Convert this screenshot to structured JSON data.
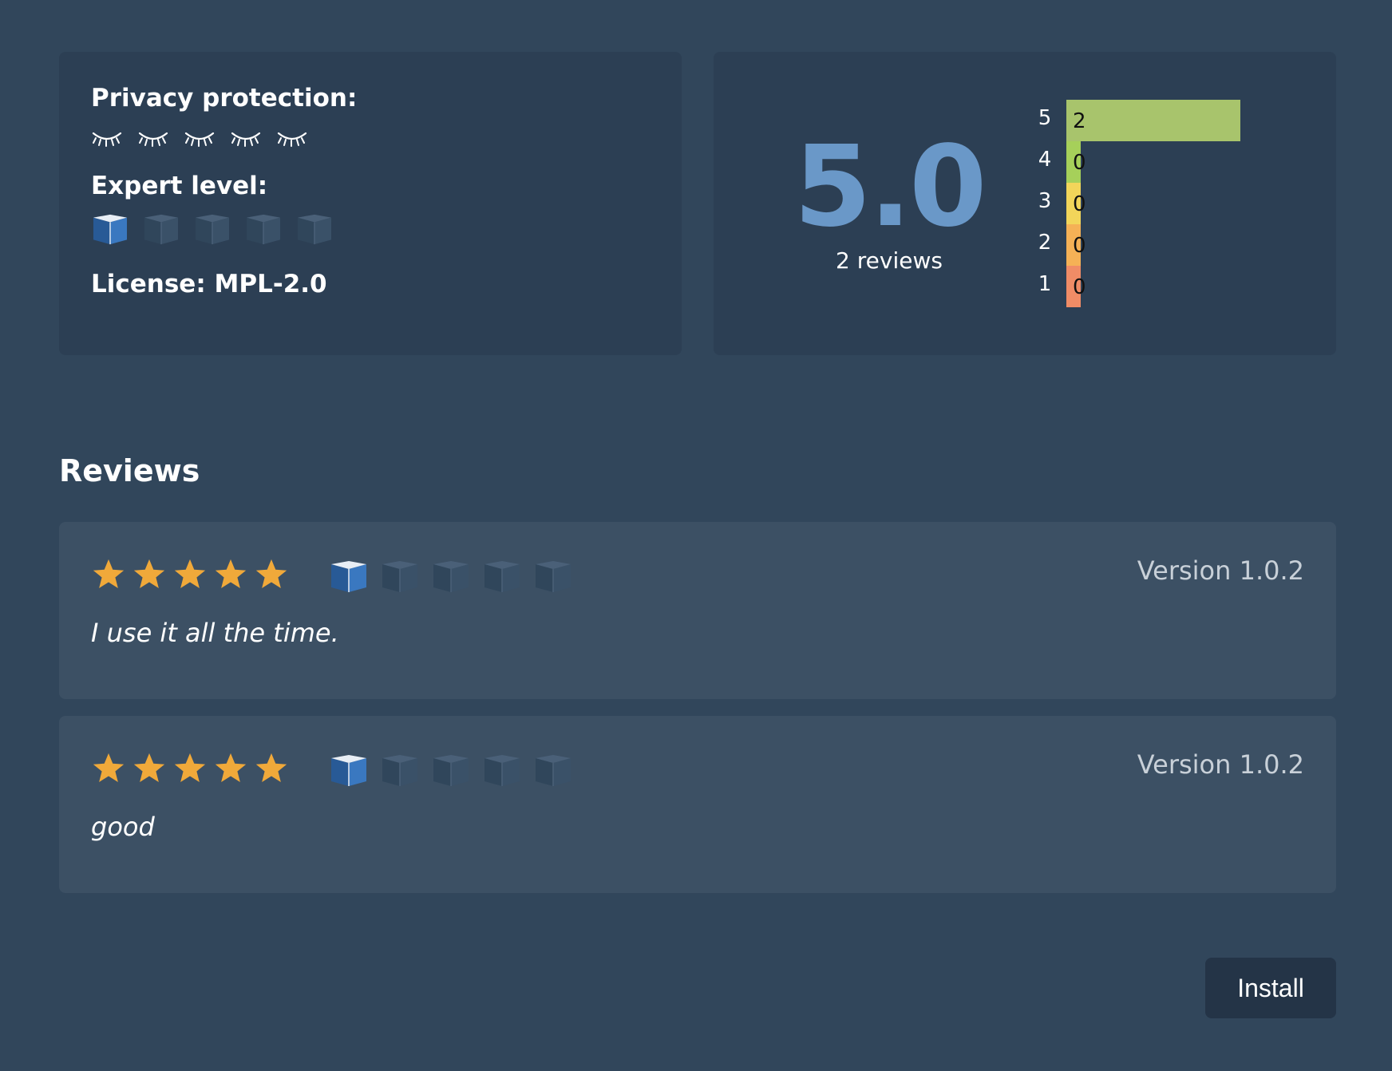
{
  "info": {
    "privacy_label": "Privacy protection:",
    "privacy_icon": "closed-eye-icon",
    "privacy_level": 5,
    "privacy_max": 5,
    "expert_label": "Expert level:",
    "expert_icon": "book-icon",
    "expert_level": 1,
    "expert_max": 5,
    "license_text": "License: MPL-2.0"
  },
  "rating": {
    "score": "5.0",
    "count_text": "2 reviews",
    "distribution": [
      {
        "stars": "5",
        "count": 2,
        "color": "#a8c46c"
      },
      {
        "stars": "4",
        "count": 0,
        "color": "#a6d05a"
      },
      {
        "stars": "3",
        "count": 0,
        "color": "#f2d55a"
      },
      {
        "stars": "2",
        "count": 0,
        "color": "#f5b156"
      },
      {
        "stars": "1",
        "count": 0,
        "color": "#f08c66"
      }
    ]
  },
  "reviews_title": "Reviews",
  "reviews": [
    {
      "stars": 5,
      "expert_level": 1,
      "version": "Version 1.0.2",
      "text": "I use it all the time."
    },
    {
      "stars": 5,
      "expert_level": 1,
      "version": "Version 1.0.2",
      "text": "good"
    }
  ],
  "colors": {
    "background": "#31465b",
    "card": "#2c3f54",
    "review_card": "#3c5064",
    "score": "#6a98c8",
    "star": "#f0a93a",
    "book_active": "#3a78c0",
    "book_inactive": "#3a5168",
    "button": "#243447"
  },
  "actions": {
    "install_label": "Install"
  }
}
